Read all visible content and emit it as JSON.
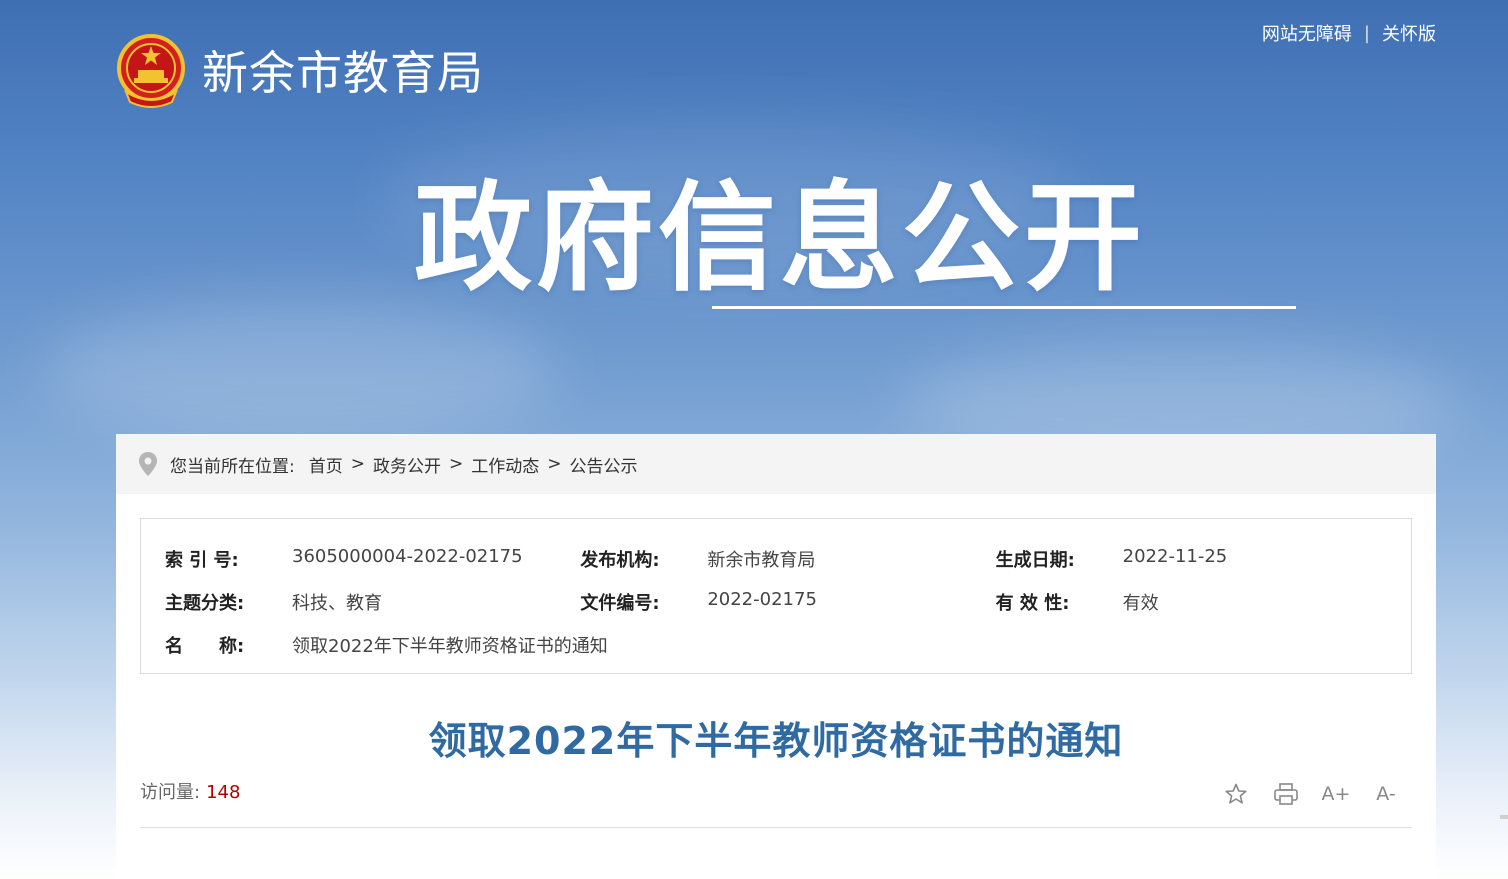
{
  "header": {
    "site_name": "新余市教育局",
    "links": [
      "网站无障碍",
      "关怀版"
    ],
    "link_separator": "|"
  },
  "banner": {
    "title": "政府信息公开"
  },
  "breadcrumb": {
    "prefix": "您当前所在位置:",
    "items": [
      "首页",
      "政务公开",
      "工作动态",
      "公告公示"
    ],
    "separator": ">"
  },
  "meta": {
    "index_label": "索 引 号:",
    "index_value": "3605000004-2022-02175",
    "publisher_label": "发布机构:",
    "publisher_value": "新余市教育局",
    "date_label": "生成日期:",
    "date_value": "2022-11-25",
    "topic_label": "主题分类:",
    "topic_value": "科技、教育",
    "doc_label": "文件编号:",
    "doc_value": "2022-02175",
    "validity_label": "有 效 性:",
    "validity_value": "有效",
    "name_label": "名　　称:",
    "name_value": "领取2022年下半年教师资格证书的通知"
  },
  "article": {
    "title": "领取2022年下半年教师资格证书的通知",
    "visits_label": "访问量:",
    "visits_count": "148"
  },
  "tools": {
    "icons": [
      "star-icon",
      "print-icon",
      "font-increase-icon",
      "font-decrease-icon"
    ],
    "font_increase": "A+",
    "font_decrease": "A-"
  },
  "colors": {
    "title_blue": "#2f6aa3",
    "visit_red": "#b30000"
  }
}
